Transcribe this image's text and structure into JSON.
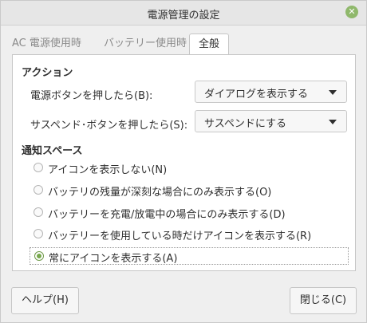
{
  "window": {
    "title": "電源管理の設定"
  },
  "tabs": [
    {
      "label": "AC 電源使用時"
    },
    {
      "label": "バッテリー使用時"
    },
    {
      "label": "全般"
    }
  ],
  "actions": {
    "heading": "アクション",
    "power_button_label": "電源ボタンを押したら(B):",
    "power_button_value": "ダイアログを表示する",
    "suspend_button_label": "サスペンド･ボタンを押したら(S):",
    "suspend_button_value": "サスペンドにする"
  },
  "tray": {
    "heading": "通知スペース",
    "options": [
      {
        "label": "アイコンを表示しない(N)"
      },
      {
        "label": "バッテリの残量が深刻な場合にのみ表示する(O)"
      },
      {
        "label": "バッテリーを充電/放電中の場合にのみ表示する(D)"
      },
      {
        "label": "バッテリーを使用している時だけアイコンを表示する(R)"
      },
      {
        "label": "常にアイコンを表示する(A)"
      }
    ],
    "selected_index": 4
  },
  "buttons": {
    "help": "ヘルプ(H)",
    "close": "閉じる(C)"
  }
}
